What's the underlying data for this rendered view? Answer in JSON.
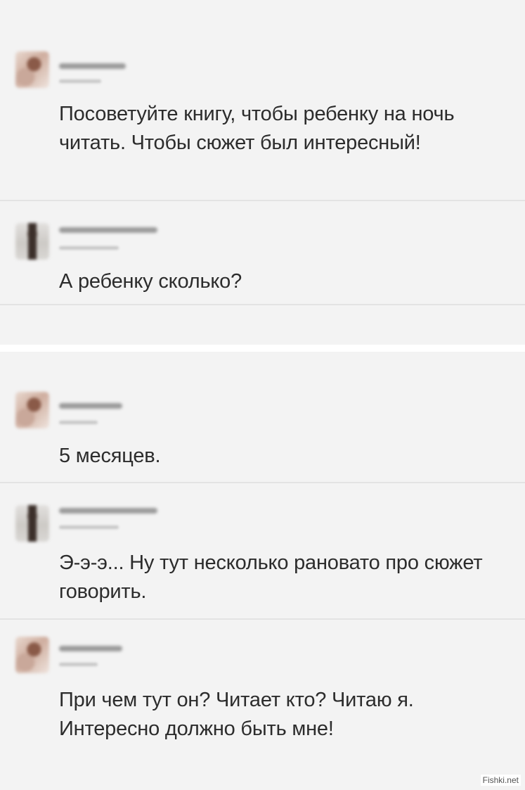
{
  "posts": [
    {
      "avatar": "blurred-user-avatar",
      "text": "Посоветуйте книгу, чтобы ребенку на ночь читать. Чтобы сюжет был интересный!"
    },
    {
      "avatar": "blurred-user-avatar",
      "text": "А ребенку сколько?"
    },
    {
      "avatar": "blurred-user-avatar",
      "text": "5 месяцев."
    },
    {
      "avatar": "blurred-user-avatar",
      "text": "Э-э-э... Ну тут несколько рановато про сюжет говорить."
    },
    {
      "avatar": "blurred-user-avatar",
      "text": "При чем тут он? Читает кто? Читаю я. Интересно должно быть мне!"
    }
  ],
  "watermark": "Fishki.net",
  "colors": {
    "panel_background": "#f3f3f3",
    "divider": "#e3e3e3",
    "text": "#2c2c2c"
  }
}
